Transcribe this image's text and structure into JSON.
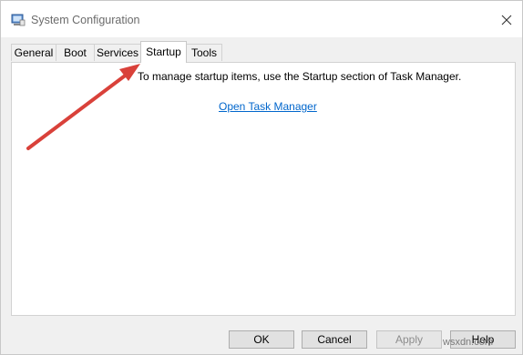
{
  "window": {
    "title": "System Configuration",
    "icon": "system-config-icon"
  },
  "tabs": [
    {
      "label": "General",
      "active": false
    },
    {
      "label": "Boot",
      "active": false
    },
    {
      "label": "Services",
      "active": false
    },
    {
      "label": "Startup",
      "active": true
    },
    {
      "label": "Tools",
      "active": false
    }
  ],
  "startup_panel": {
    "message": "To manage startup items, use the Startup section of Task Manager.",
    "link_text": "Open Task Manager"
  },
  "buttons": {
    "ok": "OK",
    "cancel": "Cancel",
    "apply": "Apply",
    "help": "Help"
  },
  "annotation": {
    "arrow_color": "#d9413a"
  },
  "watermark": "wsxdn.com"
}
